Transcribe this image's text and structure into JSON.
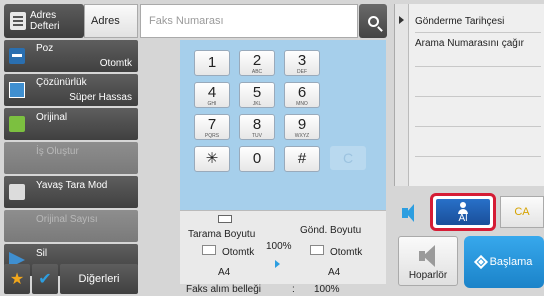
{
  "top_bar": {
    "address_book_label_line1": "Adres",
    "address_book_label_line2": "Defteri",
    "address_button_label": "Adres",
    "fax_number_placeholder": "Faks Numarası",
    "fax_number_value": ""
  },
  "left_menu": {
    "poz": {
      "label": "Poz",
      "value": "Otomtk"
    },
    "resolution": {
      "label": "Çözünürlük",
      "value": "Süper Hassas"
    },
    "original": {
      "label": "Orijinal"
    },
    "create_job": {
      "label": "İş Oluştur"
    },
    "slow_scan": {
      "label": "Yavaş Tara Mod"
    },
    "original_count": {
      "label": "Orijinal Sayısı"
    },
    "erase": {
      "label": "Sil"
    },
    "others": {
      "label": "Diğerleri"
    }
  },
  "keypad": {
    "keys": [
      {
        "num": "1",
        "sub": ""
      },
      {
        "num": "2",
        "sub": "ABC"
      },
      {
        "num": "3",
        "sub": "DEF"
      },
      {
        "num": "4",
        "sub": "GHI"
      },
      {
        "num": "5",
        "sub": "JKL"
      },
      {
        "num": "6",
        "sub": "MNO"
      },
      {
        "num": "7",
        "sub": "PQRS"
      },
      {
        "num": "8",
        "sub": "TUV"
      },
      {
        "num": "9",
        "sub": "WXYZ"
      },
      {
        "num": "✳",
        "sub": ""
      },
      {
        "num": "0",
        "sub": ""
      },
      {
        "num": "#",
        "sub": ""
      }
    ],
    "clear_label": "C"
  },
  "scan_info": {
    "scan_size_label": "Tarama Boyutu",
    "send_size_label": "Gönd. Boyutu",
    "ratio": "100%",
    "scan_mode": "Otomtk",
    "send_mode": "Otomtk",
    "scan_paper": "A4",
    "send_paper": "A4"
  },
  "fax_memory": {
    "label": "Faks alım belleği",
    "sep": ":",
    "value": "100%"
  },
  "right_panel": {
    "items": [
      {
        "label": "Gönderme Tarihçesi"
      },
      {
        "label": "Arama Numarasını çağır"
      }
    ],
    "receive_label": "Al",
    "ca_label": "CA",
    "speaker_label": "Hoparlör",
    "start_label": "Başlama"
  },
  "colors": {
    "accent": "#2d9ee0",
    "highlight": "#d51c35",
    "keypad_bg": "#a6cfeb"
  }
}
